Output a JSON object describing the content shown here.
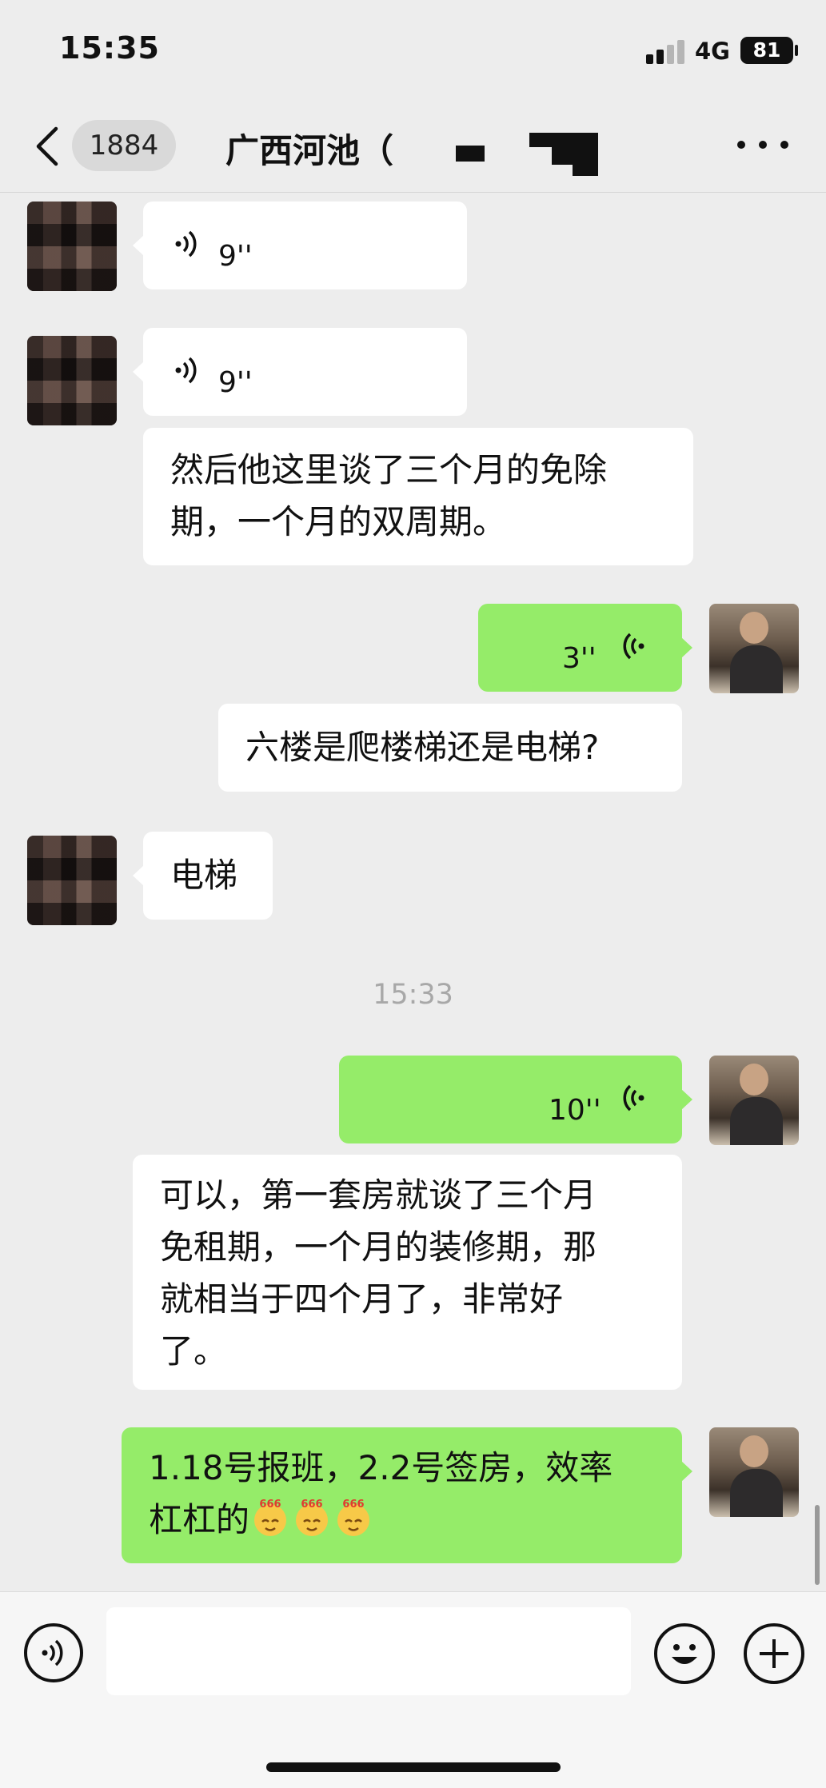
{
  "status_bar": {
    "time": "15:35",
    "network": "4G",
    "battery": "81"
  },
  "nav": {
    "unread_count": "1884",
    "title": "广西河池（"
  },
  "messages": [
    {
      "side": "in",
      "kind": "voice",
      "duration": "9''"
    },
    {
      "side": "in",
      "kind": "voice",
      "duration": "9''"
    },
    {
      "side": "in",
      "kind": "text",
      "text": "然后他这里谈了三个月的免除\n期，一个月的双周期。"
    },
    {
      "side": "out",
      "kind": "voice",
      "duration": "3''"
    },
    {
      "side": "out",
      "kind": "text",
      "text": "六楼是爬楼梯还是电梯?"
    },
    {
      "side": "in",
      "kind": "text",
      "text": "电梯"
    },
    {
      "side": "out",
      "kind": "voice",
      "duration": "10''"
    },
    {
      "side": "out",
      "kind": "text",
      "text": "可以，第一套房就谈了三个月\n免租期，一个月的装修期，那\n就相当于四个月了，非常好\n了。"
    },
    {
      "side": "out",
      "kind": "text",
      "line1": "1.18号报班，2.2号签房，效率",
      "line2": "杠杠的"
    }
  ],
  "timestamp": "15:33",
  "emoji": {
    "name": "666-emoji",
    "label": "666",
    "count": 3
  },
  "colors": {
    "background": "#ededed",
    "bubble_out": "#95ec69",
    "bubble_in": "#ffffff"
  },
  "icons": [
    "back-icon",
    "more-icon",
    "voice-wave-icon",
    "voice-input-icon",
    "emoji-icon",
    "plus-icon"
  ]
}
